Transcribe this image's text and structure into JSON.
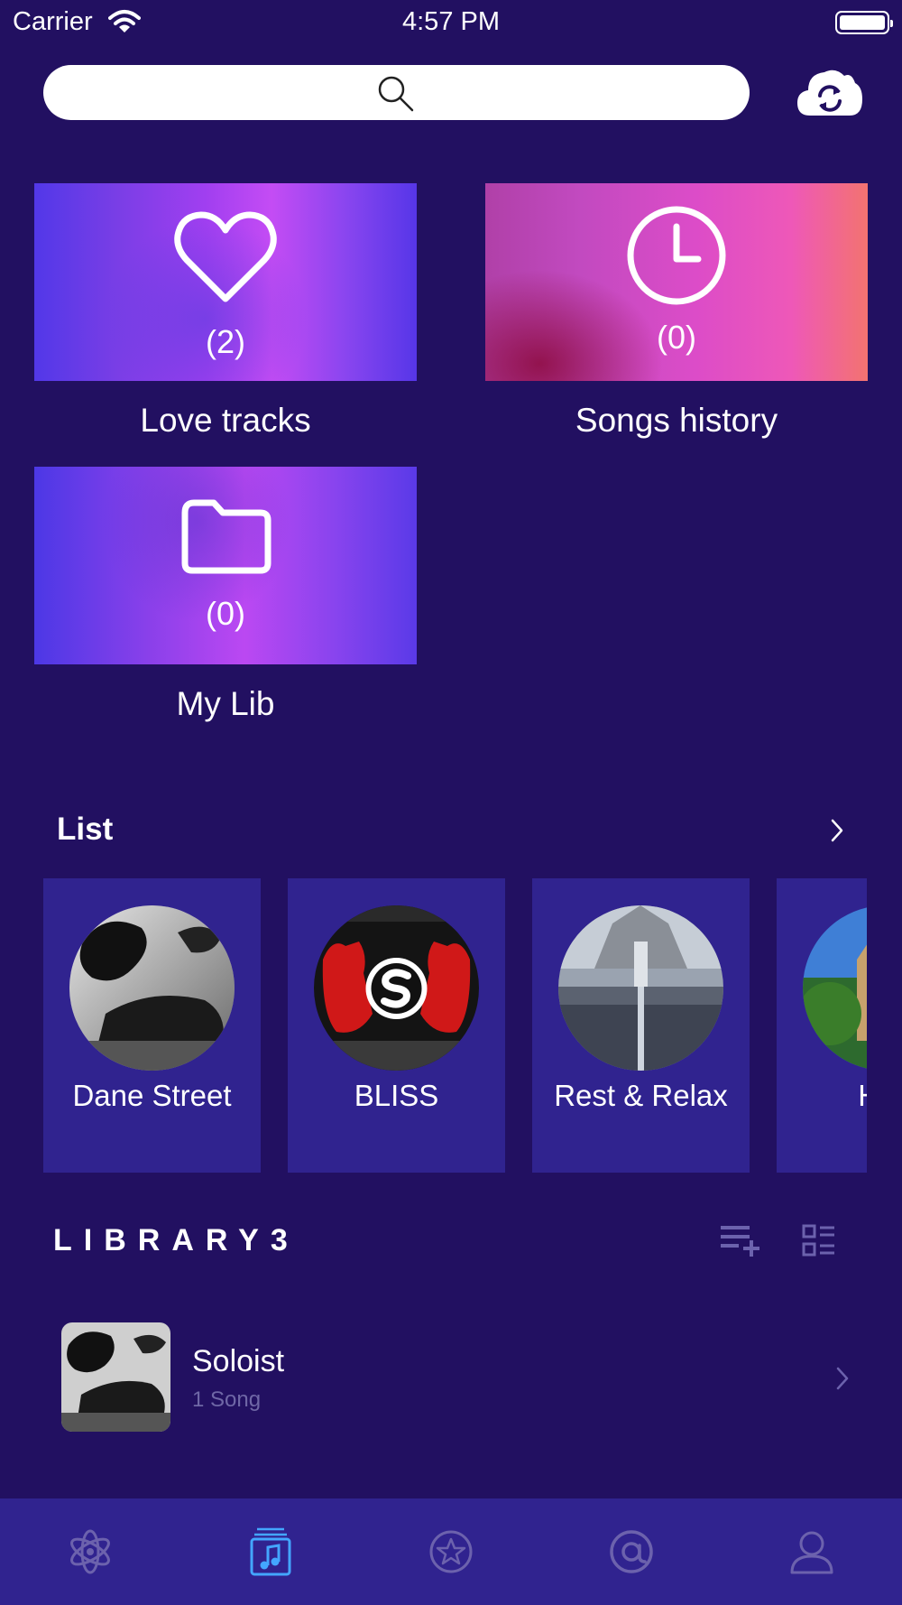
{
  "status_bar": {
    "carrier": "Carrier",
    "time": "4:57 PM"
  },
  "search": {
    "placeholder": "",
    "value": ""
  },
  "cards": [
    {
      "icon": "heart-icon",
      "count": "(2)",
      "title": "Love tracks"
    },
    {
      "icon": "clock-icon",
      "count": "(0)",
      "title": "Songs history"
    },
    {
      "icon": "folder-icon",
      "count": "(0)",
      "title": "My Lib"
    }
  ],
  "list": {
    "title": "List",
    "items": [
      {
        "name": "Dane Street"
      },
      {
        "name": "BLISS"
      },
      {
        "name": "Rest & Relax"
      },
      {
        "name": "Hap"
      }
    ]
  },
  "library": {
    "title": "LIBRARY3",
    "items": [
      {
        "title": "Soloist",
        "subtitle": "1 Song"
      }
    ]
  },
  "tab_bar": {
    "active_index": 1,
    "tabs": [
      {
        "icon": "atom-icon"
      },
      {
        "icon": "music-note-icon"
      },
      {
        "icon": "star-icon"
      },
      {
        "icon": "at-sign-icon"
      },
      {
        "icon": "profile-icon"
      }
    ]
  },
  "colors": {
    "background": "#221061",
    "panel": "#30238f",
    "active_tab": "#43a6ff",
    "inactive_tab": "#6c62ad",
    "muted_text": "#6f67a6"
  }
}
